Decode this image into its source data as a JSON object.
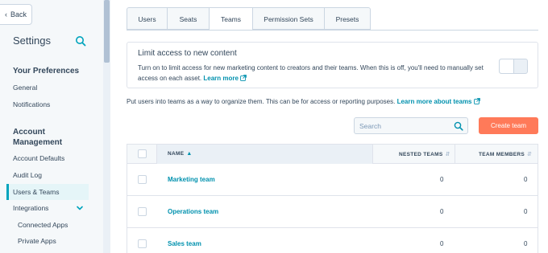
{
  "sidebar": {
    "back_label": "Back",
    "title": "Settings",
    "sections": {
      "preferences": {
        "heading": "Your Preferences",
        "items": [
          "General",
          "Notifications"
        ]
      },
      "account": {
        "heading": "Account Management",
        "items": [
          "Account Defaults",
          "Audit Log",
          "Users & Teams",
          "Integrations",
          "Connected Apps",
          "Private Apps"
        ],
        "active": "Users & Teams"
      }
    }
  },
  "tabs": [
    {
      "label": "Users",
      "active": false
    },
    {
      "label": "Seats",
      "active": false
    },
    {
      "label": "Teams",
      "active": true
    },
    {
      "label": "Permission Sets",
      "active": false
    },
    {
      "label": "Presets",
      "active": false
    }
  ],
  "limit_card": {
    "title": "Limit access to new content",
    "description": "Turn on to limit access for new marketing content to creators and their teams. When this is off, you'll need to manually set access on each asset.",
    "link": "Learn more",
    "toggle_on": false
  },
  "intro": {
    "text": "Put users into teams as a way to organize them. This can be for access or reporting purposes.",
    "link": "Learn more about teams"
  },
  "search": {
    "placeholder": "Search"
  },
  "create_button": "Create team",
  "table": {
    "columns": [
      "NAME",
      "NESTED TEAMS",
      "TEAM MEMBERS"
    ],
    "rows": [
      {
        "name": "Marketing team",
        "nested": "0",
        "members": "0"
      },
      {
        "name": "Operations team",
        "nested": "0",
        "members": "0"
      },
      {
        "name": "Sales team",
        "nested": "0",
        "members": "0"
      }
    ]
  },
  "colors": {
    "accent": "#0091ae",
    "primary_button": "#ff7a59",
    "active_nav": "#e5f5f8"
  }
}
